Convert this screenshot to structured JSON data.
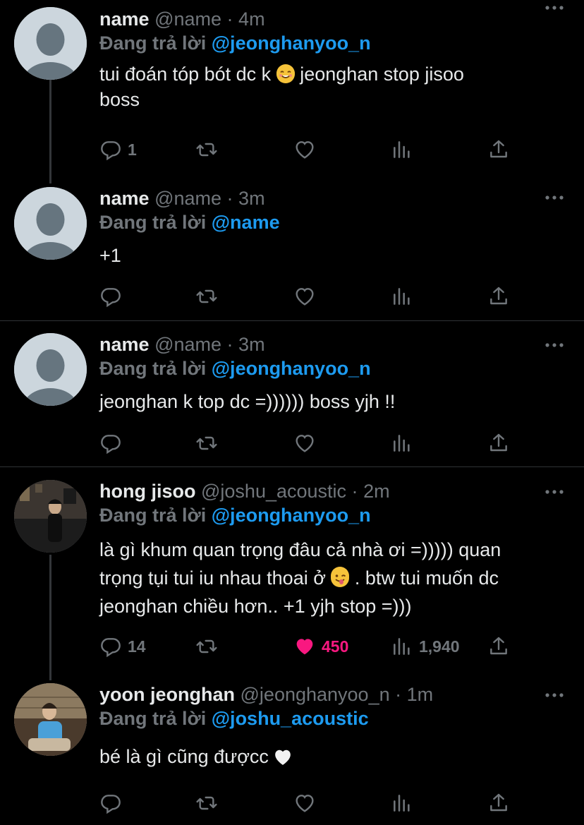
{
  "reply_prefix": "Đang trả lời",
  "tweets": [
    {
      "name": "name",
      "handle": "@name",
      "time": "4m",
      "reply_to": "@jeonghanyoo_n",
      "text_line1": "tui đoán tóp bót dc k ",
      "text_line1b": " jeonghan stop jisoo",
      "text_line2": "boss",
      "replies": "1",
      "retweets": "",
      "likes": "",
      "views": ""
    },
    {
      "name": "name",
      "handle": "@name",
      "time": "3m",
      "reply_to": "@name",
      "text_line1": "+1",
      "replies": "",
      "retweets": "",
      "likes": "",
      "views": ""
    },
    {
      "name": "name",
      "handle": "@name",
      "time": "3m",
      "reply_to": "@jeonghanyoo_n",
      "text_line1": "jeonghan k top dc =)))))) boss yjh !!",
      "replies": "",
      "retweets": "",
      "likes": "",
      "views": ""
    },
    {
      "name": "hong jisoo",
      "handle": "@joshu_acoustic",
      "time": "2m",
      "reply_to": "@jeonghanyoo_n",
      "text_line1": "là gì khum quan trọng đâu cả nhà ơi =))))) quan",
      "text_line2a": "trọng tụi tui iu nhau thoai ở ",
      "text_line2b": " . btw tui muốn dc",
      "text_line3": "jeonghan chiều hơn.. +1 yjh stop =)))",
      "replies": "14",
      "retweets": "",
      "likes": "450",
      "views": "1,940"
    },
    {
      "name": "yoon jeonghan",
      "handle": "@jeonghanyoo_n",
      "time": "1m",
      "reply_to": "@joshu_acoustic",
      "text_line1": "bé là gì cũng đượcc ",
      "replies": "",
      "retweets": "",
      "likes": "",
      "views": ""
    }
  ],
  "separator": "·",
  "colors": {
    "background": "#000000",
    "link": "#1d9bf0",
    "muted": "#71767b",
    "like": "#f91880"
  },
  "icons": [
    "reply-icon",
    "retweet-icon",
    "like-icon",
    "views-icon",
    "share-icon",
    "more-icon"
  ]
}
